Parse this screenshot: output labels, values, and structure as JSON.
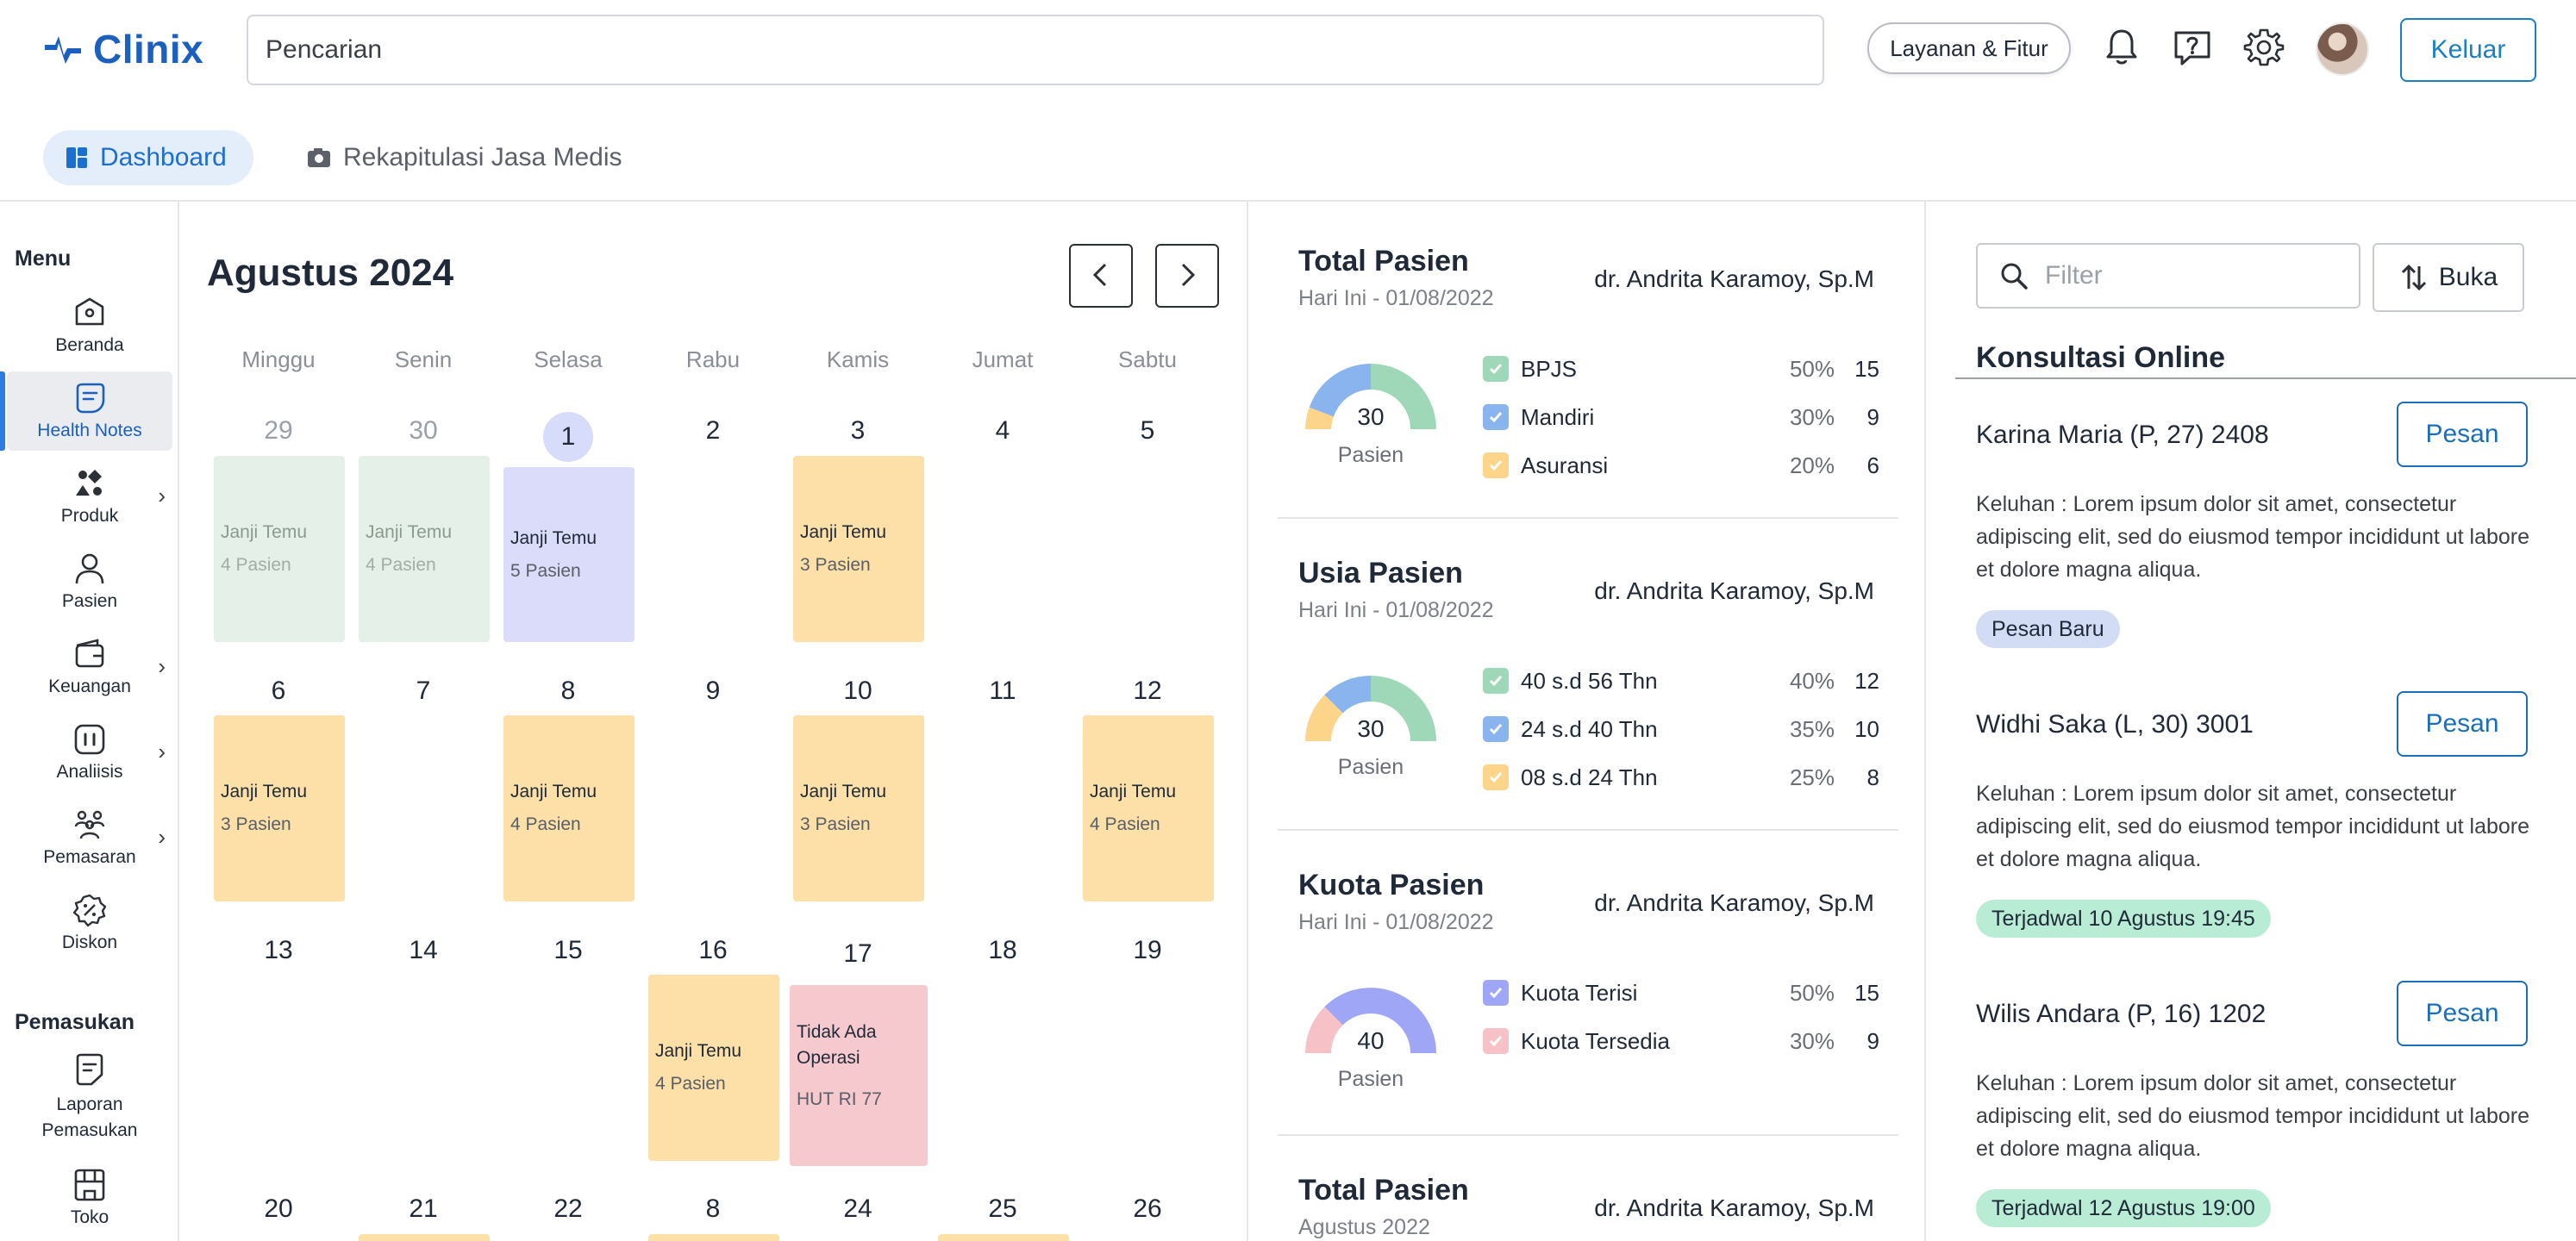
{
  "header": {
    "brand": "Clinix",
    "search_placeholder": "Pencarian",
    "services_label": "Layanan & Fitur",
    "logout_label": "Keluar",
    "icons": [
      "bell-icon",
      "help-icon",
      "gear-icon"
    ]
  },
  "tabs": [
    {
      "label": "Dashboard",
      "active": true
    },
    {
      "label": "Rekapitulasi Jasa Medis",
      "active": false
    }
  ],
  "sidebar": {
    "menu_heading": "Menu",
    "items": [
      {
        "label": "Beranda",
        "icon": "home-icon",
        "submenu": false
      },
      {
        "label": "Health Notes",
        "icon": "notes-icon",
        "submenu": false,
        "active": true
      },
      {
        "label": "Produk",
        "icon": "product-icon",
        "submenu": true
      },
      {
        "label": "Pasien",
        "icon": "user-icon",
        "submenu": false
      },
      {
        "label": "Keuangan",
        "icon": "wallet-icon",
        "submenu": true
      },
      {
        "label": "Analiisis",
        "icon": "analysis-icon",
        "submenu": true
      },
      {
        "label": "Pemasaran",
        "icon": "marketing-icon",
        "submenu": true
      },
      {
        "label": "Diskon",
        "icon": "discount-icon",
        "submenu": false
      }
    ],
    "income_heading": "Pemasukan",
    "income_items": [
      {
        "label": "Laporan Pemasukan",
        "icon": "report-icon"
      },
      {
        "label": "Toko",
        "icon": "store-icon"
      }
    ]
  },
  "calendar": {
    "title": "Agustus 2024",
    "weekdays": [
      "Minggu",
      "Senin",
      "Selasa",
      "Rabu",
      "Kamis",
      "Jumat",
      "Sabtu"
    ],
    "weeks": [
      [
        "29",
        "30",
        "1",
        "2",
        "3",
        "4",
        "5"
      ],
      [
        "6",
        "7",
        "8",
        "9",
        "10",
        "11",
        "12"
      ],
      [
        "13",
        "14",
        "15",
        "16",
        "17",
        "18",
        "19"
      ],
      [
        "20",
        "21",
        "22",
        "8",
        "24",
        "25",
        "26"
      ]
    ],
    "event_title": "Janji Temu",
    "events": {
      "e29": "4 Pasien",
      "e30": "4 Pasien",
      "e1": "5 Pasien",
      "e3": "3 Pasien",
      "e6": "3 Pasien",
      "e8": "4 Pasien",
      "e10": "3 Pasien",
      "e12": "4 Pasien",
      "e16": "4 Pasien"
    },
    "special_event": {
      "title": "Tidak Ada Operasi",
      "sub": "HUT RI 77"
    }
  },
  "stats": [
    {
      "title": "Total Pasien",
      "sub": "Hari Ini - 01/08/2022",
      "doctor": "dr. Andrita Karamoy, Sp.M",
      "center_value": "30",
      "center_label": "Pasien",
      "rows": [
        {
          "name": "BPJS",
          "pct": "50%",
          "val": "15",
          "color": "#9fd8b8"
        },
        {
          "name": "Mandiri",
          "pct": "30%",
          "val": "9",
          "color": "#8ab4ee"
        },
        {
          "name": "Asuransi",
          "pct": "20%",
          "val": "6",
          "color": "#fcd58a"
        }
      ]
    },
    {
      "title": "Usia Pasien",
      "sub": "Hari Ini - 01/08/2022",
      "doctor": "dr. Andrita Karamoy, Sp.M",
      "center_value": "30",
      "center_label": "Pasien",
      "rows": [
        {
          "name": "40 s.d 56 Thn",
          "pct": "40%",
          "val": "12",
          "color": "#9fd8b8"
        },
        {
          "name": "24 s.d 40 Thn",
          "pct": "35%",
          "val": "10",
          "color": "#8ab4ee"
        },
        {
          "name": "08 s.d 24 Thn",
          "pct": "25%",
          "val": "8",
          "color": "#fcd58a"
        }
      ]
    },
    {
      "title": "Kuota Pasien",
      "sub": "Hari Ini - 01/08/2022",
      "doctor": "dr. Andrita Karamoy, Sp.M",
      "center_value": "40",
      "center_label": "Pasien",
      "rows": [
        {
          "name": "Kuota Terisi",
          "pct": "50%",
          "val": "15",
          "color": "#9ea6f5"
        },
        {
          "name": "Kuota Tersedia",
          "pct": "30%",
          "val": "9",
          "color": "#f6c2c8"
        }
      ]
    },
    {
      "title": "Total Pasien",
      "sub": "Agustus 2022",
      "doctor": "dr. Andrita Karamoy, Sp.M"
    }
  ],
  "konsultasi": {
    "filter_placeholder": "Filter",
    "sort_label": "Buka",
    "title": "Konsultasi Online",
    "action_label": "Pesan",
    "items": [
      {
        "name": "Karina Maria (P, 27) 2408",
        "complaint": "Keluhan : Lorem ipsum dolor sit amet, consectetur adipiscing elit, sed do eiusmod tempor incididunt ut labore et dolore magna aliqua.",
        "tag": "Pesan Baru"
      },
      {
        "name": "Widhi Saka (L, 30) 3001",
        "complaint": "Keluhan : Lorem ipsum dolor sit amet, consectetur adipiscing elit, sed do eiusmod tempor incididunt ut labore et dolore magna aliqua.",
        "tag": "Terjadwal 10 Agustus 19:45"
      },
      {
        "name": "Wilis Andara (P, 16) 1202",
        "complaint": "Keluhan : Lorem ipsum dolor sit amet, consectetur adipiscing elit, sed do eiusmod tempor incididunt ut labore et dolore magna aliqua.",
        "tag": "Terjadwal 12 Agustus 19:00"
      }
    ]
  },
  "colors": {
    "brand": "#1b5fbf",
    "accent": "#1b7fc4",
    "green": "#9fd8b8",
    "blue": "#8ab4ee",
    "orange": "#fcd58a",
    "purple": "#9ea6f5",
    "pink": "#f6c2c8"
  }
}
